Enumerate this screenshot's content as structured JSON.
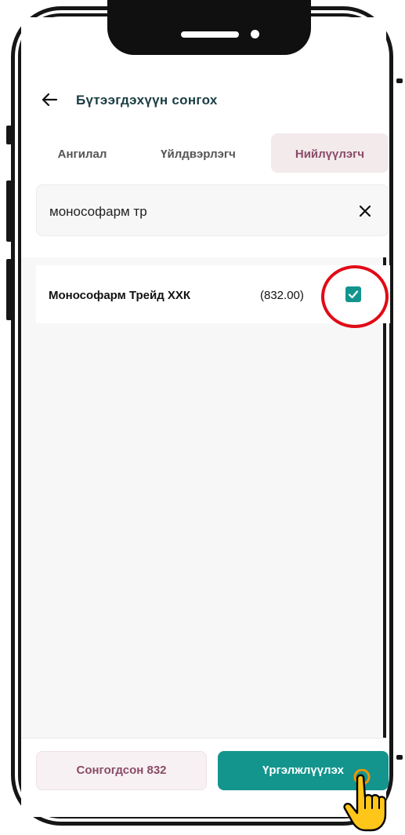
{
  "header": {
    "title": "Бүтээгдэхүүн сонгох"
  },
  "tabs": [
    {
      "label": "Ангилал",
      "active": false
    },
    {
      "label": "Үйлдвэрлэгч",
      "active": false
    },
    {
      "label": "Нийлүүлэгч",
      "active": true
    }
  ],
  "search": {
    "value": "монософарм тр"
  },
  "results": [
    {
      "name": "Монософарм Трейд ХХК",
      "count": "(832.00)",
      "checked": true
    }
  ],
  "footer": {
    "selected_label": "Сонгогдсон 832",
    "continue_label": "Үргэлжлүүлэх"
  },
  "colors": {
    "accent": "#13958e",
    "tab_active_text": "#8a4b67",
    "highlight": "#e10b16"
  },
  "icons": [
    "back-arrow-icon",
    "close-icon",
    "check-icon",
    "pointer-hand-icon"
  ]
}
